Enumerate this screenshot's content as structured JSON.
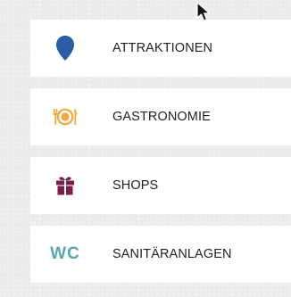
{
  "menu": {
    "items": [
      {
        "label": "ATTRAKTIONEN",
        "icon": "map-pin-icon",
        "icon_color": "#2a5da8"
      },
      {
        "label": "GASTRONOMIE",
        "icon": "plate-cutlery-icon",
        "icon_color": "#f2a93b"
      },
      {
        "label": "SHOPS",
        "icon": "gift-icon",
        "icon_color": "#7a1e4a"
      },
      {
        "label": "SANITÄRANLAGEN",
        "icon": "wc-icon",
        "icon_text": "WC",
        "icon_color": "#5aa6ad"
      }
    ]
  },
  "colors": {
    "background": "#eeeeec",
    "card": "#ffffff",
    "text": "#222222"
  }
}
